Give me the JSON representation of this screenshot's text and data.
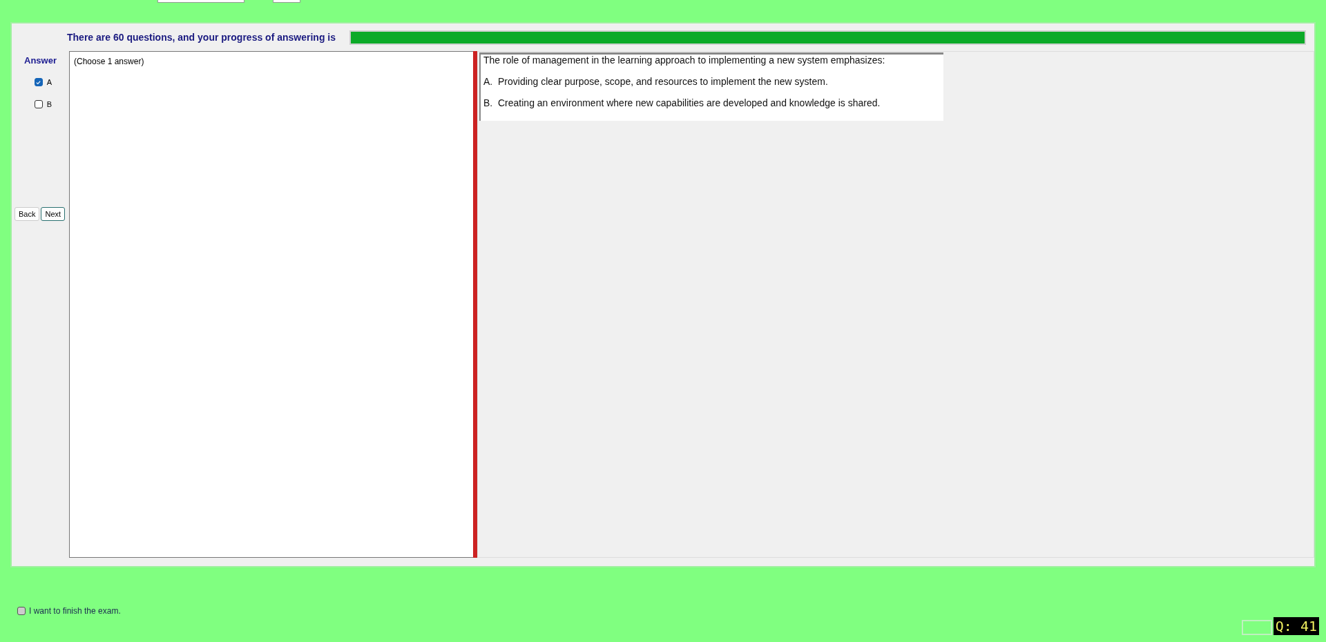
{
  "progress": {
    "label": "There are 60 questions, and your progress of answering is",
    "level": 1
  },
  "answer": {
    "heading": "Answer",
    "options": [
      {
        "label": "A",
        "checked": true
      },
      {
        "label": "B",
        "checked": false
      }
    ]
  },
  "nav_buttons": [
    "Back",
    "Next"
  ],
  "answer_pane": {
    "hint": "(Choose 1 answer)"
  },
  "question": {
    "text": "The role of management in the learning approach to implementing a new system emphasizes:",
    "choices": [
      "A.  Providing clear purpose, scope, and resources to implement the new system.",
      "B.  Creating an environment where new capabilities are developed and knowledge is shared."
    ]
  },
  "finish": {
    "label": "I want to finish the exam.",
    "checked": false
  },
  "question_counter": "Q: 41"
}
